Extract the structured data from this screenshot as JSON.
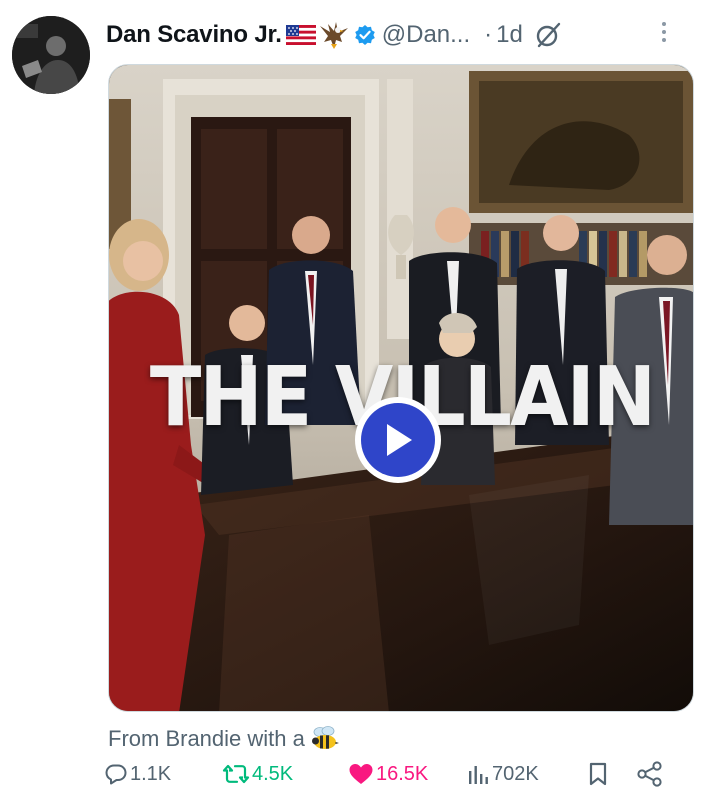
{
  "post": {
    "author_name": "Dan Scavino Jr.",
    "handle": "@Dan...",
    "separator": "·",
    "time": "1d",
    "caption": "From Brandie with a",
    "caption_emoji": "bee-icon"
  },
  "media": {
    "overlay_title": "THE VILLAIN",
    "play_icon": "play-icon"
  },
  "actions": {
    "replies": "1.1K",
    "reposts": "4.5K",
    "likes": "16.5K",
    "views": "702K"
  },
  "icons": {
    "header": [
      "us-flag-icon",
      "eagle-icon",
      "verified-badge-icon",
      "grok-icon",
      "more-options-icon"
    ],
    "actions": [
      "reply-icon",
      "retweet-icon",
      "like-icon",
      "views-icon",
      "bookmark-icon",
      "share-icon"
    ]
  },
  "colors": {
    "text_primary": "#0f1419",
    "text_secondary": "#536471",
    "verified": "#1d9bf0",
    "retweet_active": "#00ba7c",
    "like_active": "#f91880",
    "play_button": "#2f45c9"
  }
}
